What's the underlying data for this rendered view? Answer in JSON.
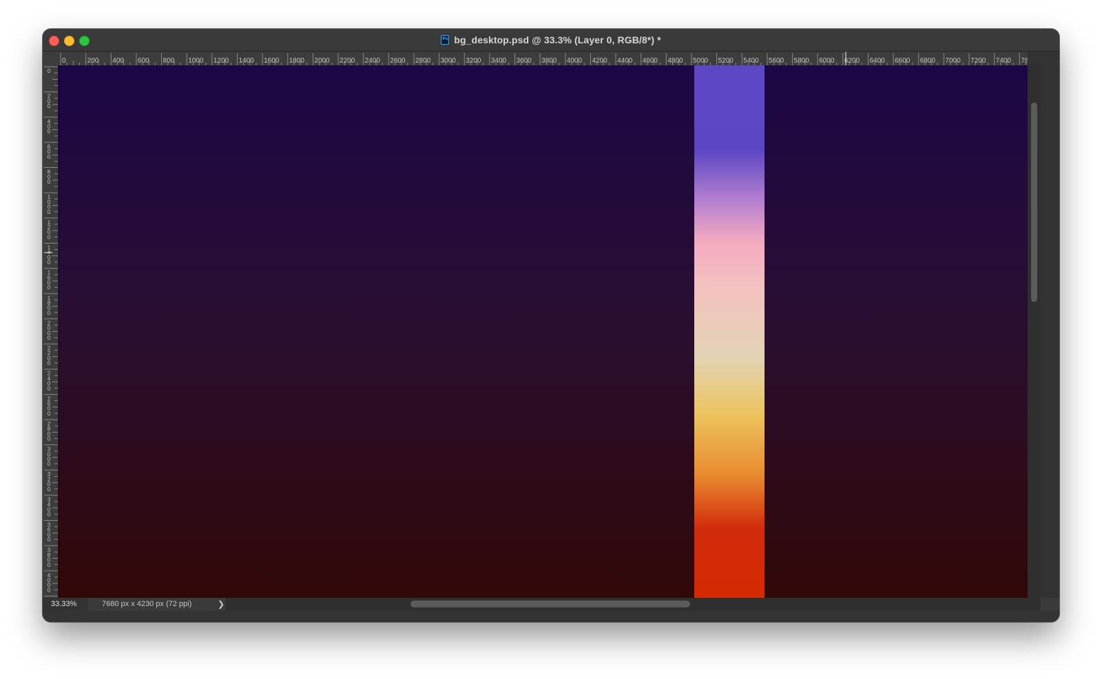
{
  "window": {
    "title": "bg_desktop.psd @ 33.3% (Layer 0, RGB/8*) *",
    "app_icon_label": "Ps"
  },
  "status": {
    "zoom": "33.33%",
    "doc_info": "7680 px x 4230 px (72 ppi)",
    "arrow": "❯"
  },
  "rulers": {
    "horizontal_labels": [
      "0",
      "200",
      "400",
      "600",
      "800",
      "1000",
      "1200",
      "1400",
      "1600",
      "1800",
      "2000",
      "2200",
      "2400",
      "2600",
      "2800",
      "3000",
      "3200",
      "3400",
      "3600",
      "3800",
      "4000",
      "4200",
      "4400",
      "4600",
      "4800",
      "5000",
      "5200",
      "5400",
      "5600",
      "5800",
      "6000",
      "6200",
      "6400",
      "6600",
      "6800",
      "7000",
      "7200",
      "7400",
      "760"
    ],
    "vertical_labels": [
      "0",
      "200",
      "400",
      "600",
      "800",
      "1000",
      "1200",
      "1400",
      "1600",
      "1800",
      "2000",
      "2200",
      "2400",
      "2600",
      "2800",
      "3000",
      "3200",
      "3400",
      "3600",
      "3800",
      "4000",
      "4"
    ]
  },
  "document": {
    "background_gradient": [
      "#1c0746",
      "#2a0e30",
      "#300807"
    ],
    "stripe_gradient": [
      {
        "stop": "0%",
        "color": "#5e46c4"
      },
      {
        "stop": "16%",
        "color": "#5d46c4"
      },
      {
        "stop": "25%",
        "color": "#b17dd0"
      },
      {
        "stop": "33%",
        "color": "#f3a9c0"
      },
      {
        "stop": "42%",
        "color": "#f3c2c0"
      },
      {
        "stop": "55%",
        "color": "#e3d3b3"
      },
      {
        "stop": "66%",
        "color": "#ecc25c"
      },
      {
        "stop": "77%",
        "color": "#e98a2e"
      },
      {
        "stop": "87%",
        "color": "#d22b0c"
      },
      {
        "stop": "100%",
        "color": "#d52a02"
      }
    ]
  }
}
